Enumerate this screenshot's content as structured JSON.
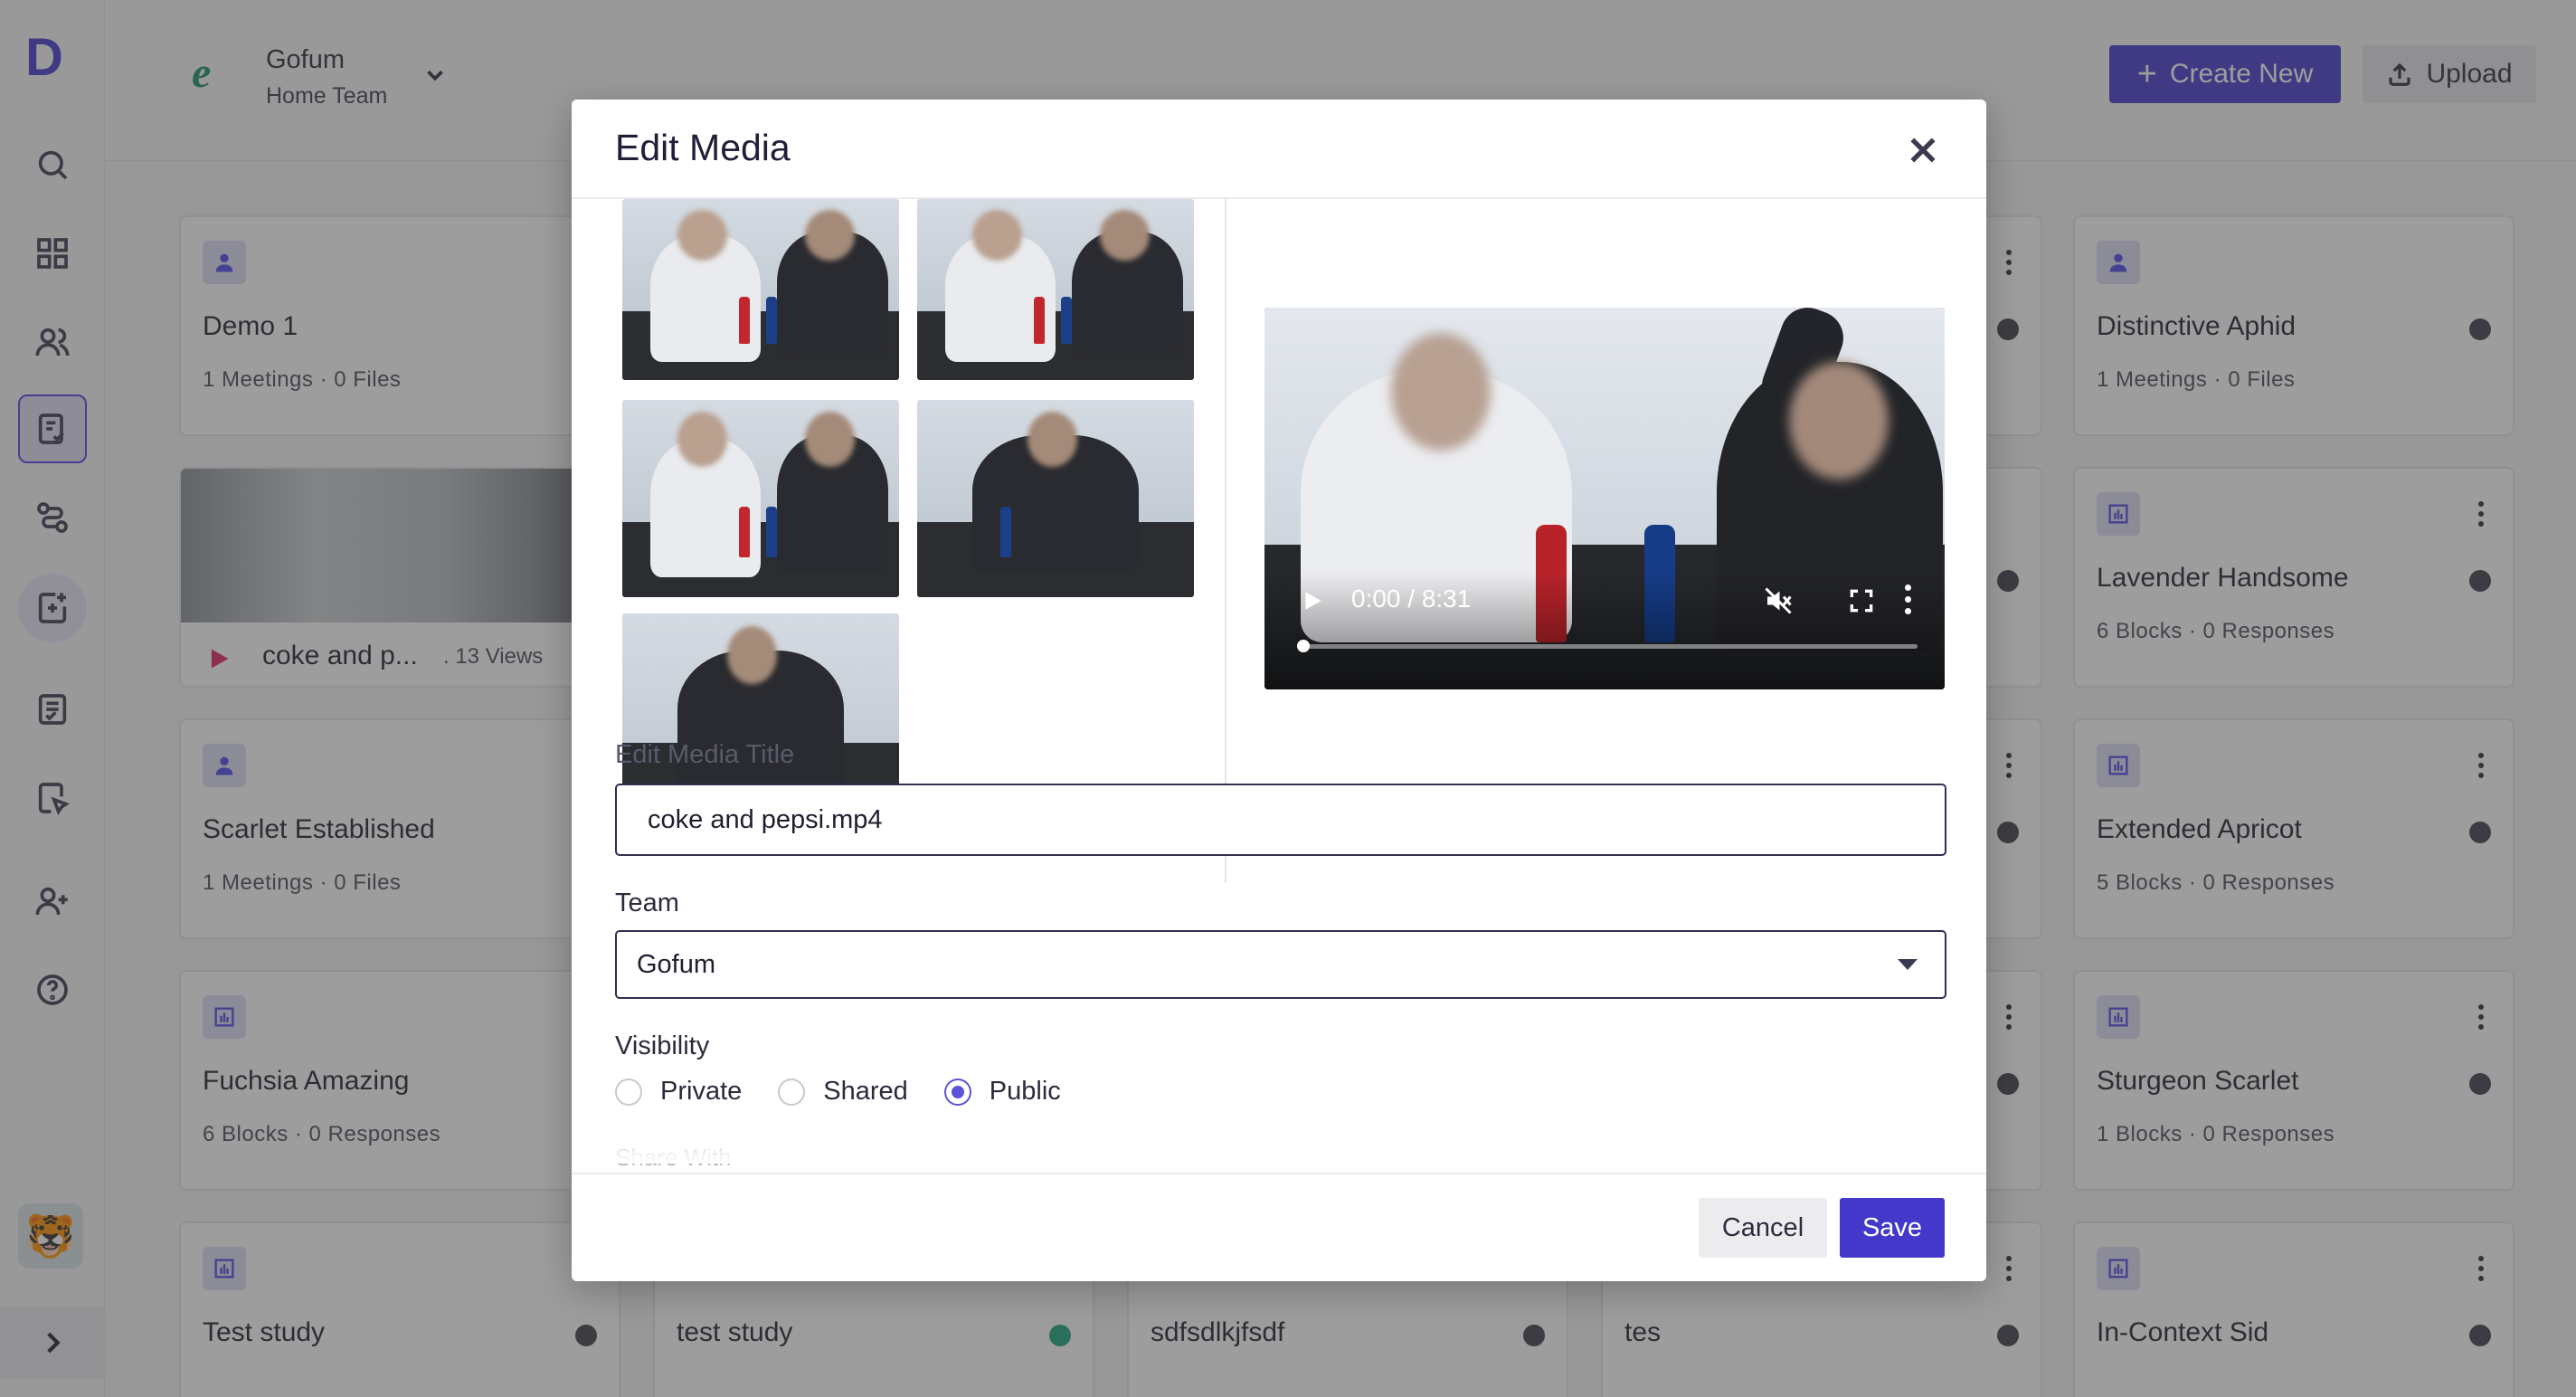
{
  "app": {
    "logo_letter": "D"
  },
  "sidebar": {
    "icons": [
      "search-icon",
      "grid-icon",
      "users-icon",
      "document-check-icon",
      "route-icon",
      "add-media-icon",
      "list-icon",
      "cursor-doc-icon",
      "add-user-icon",
      "help-icon"
    ],
    "active": "document-check-icon"
  },
  "topbar": {
    "team_name": "Gofum",
    "team_sub": "Home Team",
    "create_label": "Create New",
    "upload_label": "Upload"
  },
  "cards": [
    {
      "title": "Demo 1",
      "meta": "1 Meetings · 0 Files"
    },
    {
      "title": "Scarlet Established",
      "meta": "1 Meetings · 0 Files"
    },
    {
      "title": "Fuchsia Amazing",
      "meta": "6 Blocks · 0 Responses"
    },
    {
      "title": "Test study"
    },
    {
      "title": "test study"
    },
    {
      "title": "sdfsdlkjfsdf"
    },
    {
      "title": "tes"
    },
    {
      "title": "Distinctive Aphid",
      "meta": "1 Meetings · 0 Files"
    },
    {
      "title": "Lavender Handsome",
      "meta": "6 Blocks · 0 Responses"
    },
    {
      "title": "Extended Apricot",
      "meta": "5 Blocks · 0 Responses"
    },
    {
      "title": "Sturgeon Scarlet",
      "meta": "1 Blocks · 0 Responses"
    },
    {
      "title": "In-Context Sid"
    }
  ],
  "media_card": {
    "title": "coke and p...",
    "views": ". 13 Views"
  },
  "modal": {
    "title": "Edit Media",
    "video": {
      "time": "0:00 / 8:31",
      "progress": 0
    },
    "title_label": "Edit Media Title",
    "title_value": "coke and pepsi.mp4",
    "team_label": "Team",
    "team_value": "Gofum",
    "visibility_label": "Visibility",
    "visibility_options": [
      "Private",
      "Shared",
      "Public"
    ],
    "visibility_selected": "Public",
    "share_with_label": "Share With",
    "cancel_label": "Cancel",
    "save_label": "Save"
  },
  "colors": {
    "accent": "#4338ca",
    "radio_accent": "#5b54d6",
    "status_green": "#16a37a"
  }
}
